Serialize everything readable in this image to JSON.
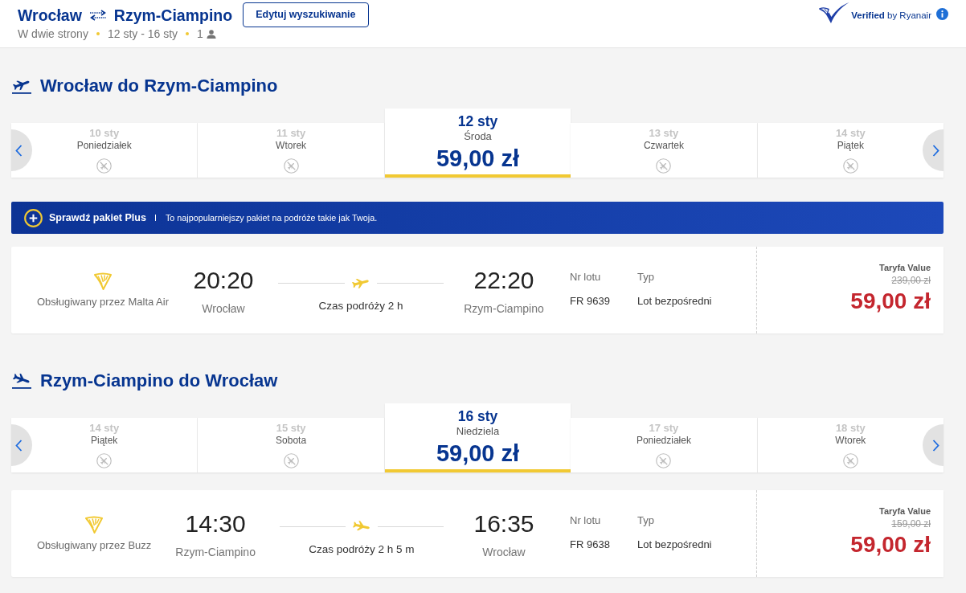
{
  "header": {
    "origin": "Wrocław",
    "destination": "Rzym-Ciampino",
    "edit_button": "Edytuj wyszukiwanie",
    "trip_type": "W dwie strony",
    "travel_dates": "12 sty - 16 sty",
    "passengers": "1",
    "verified_label": "**Verified** by Ryanair"
  },
  "sections": [
    {
      "kind": "outbound",
      "title": "Wrocław do Rzym-Ciampino",
      "dates": [
        {
          "date": "10 sty",
          "weekday": "Poniedziałek",
          "selected": false
        },
        {
          "date": "11 sty",
          "weekday": "Wtorek",
          "selected": false
        },
        {
          "date": "12 sty",
          "weekday": "Środa",
          "price": "59,00 zł",
          "selected": true
        },
        {
          "date": "13 sty",
          "weekday": "Czwartek",
          "selected": false
        },
        {
          "date": "14 sty",
          "weekday": "Piątek",
          "selected": false
        }
      ],
      "banner": {
        "title": "Sprawdź pakiet Plus",
        "text": "To najpopularniejszy pakiet na podróże takie jak Twoja."
      },
      "flight": {
        "operator": "Obsługiwany przez Malta Air",
        "departure_time": "20:20",
        "departure_city": "Wrocław",
        "duration": "Czas podróży 2 h",
        "arrival_time": "22:20",
        "arrival_city": "Rzym-Ciampino",
        "flight_number_label": "Nr lotu",
        "flight_number": "FR 9639",
        "type_label": "Typ",
        "type": "Lot bezpośredni",
        "fare_name": "Taryfa Value",
        "old_price": "239,00 zł",
        "price": "59,00 zł"
      }
    },
    {
      "kind": "inbound",
      "title": "Rzym-Ciampino do Wrocław",
      "dates": [
        {
          "date": "14 sty",
          "weekday": "Piątek",
          "selected": false
        },
        {
          "date": "15 sty",
          "weekday": "Sobota",
          "selected": false
        },
        {
          "date": "16 sty",
          "weekday": "Niedziela",
          "price": "59,00 zł",
          "selected": true
        },
        {
          "date": "17 sty",
          "weekday": "Poniedziałek",
          "selected": false
        },
        {
          "date": "18 sty",
          "weekday": "Wtorek",
          "selected": false
        }
      ],
      "flight": {
        "operator": "Obsługiwany przez Buzz",
        "departure_time": "14:30",
        "departure_city": "Rzym-Ciampino",
        "duration": "Czas podróży 2 h 5 m",
        "arrival_time": "16:35",
        "arrival_city": "Wrocław",
        "flight_number_label": "Nr lotu",
        "flight_number": "FR 9638",
        "type_label": "Typ",
        "type": "Lot bezpośredni",
        "fare_name": "Taryfa Value",
        "old_price": "159,00 zł",
        "price": "59,00 zł"
      }
    }
  ]
}
